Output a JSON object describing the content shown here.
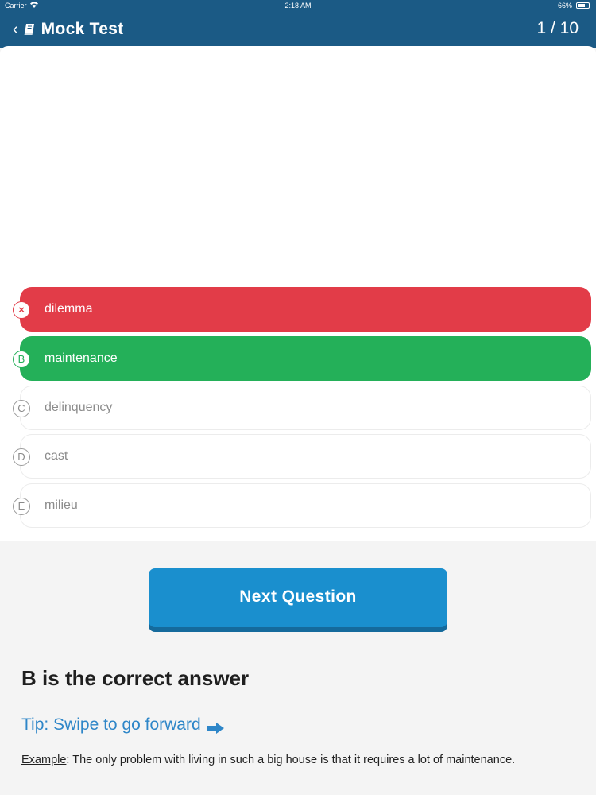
{
  "status_bar": {
    "carrier": "Carrier",
    "time": "2:18 AM",
    "battery": "66%"
  },
  "header": {
    "back_icon": "chevron-left-icon",
    "book_icon": "book-icon",
    "title": "Mock Test",
    "progress": "1 / 10",
    "bg_color": "#1b5a85"
  },
  "question": {
    "text": ""
  },
  "options": [
    {
      "marker": "×",
      "label": "dilemma",
      "state": "wrong"
    },
    {
      "marker": "B",
      "label": "maintenance",
      "state": "correct"
    },
    {
      "marker": "C",
      "label": "delinquency",
      "state": "neutral"
    },
    {
      "marker": "D",
      "label": "cast",
      "state": "neutral"
    },
    {
      "marker": "E",
      "label": "milieu",
      "state": "neutral"
    }
  ],
  "next_button": {
    "label": "Next Question"
  },
  "result": {
    "heading": "B is the correct answer",
    "tip": "Tip: Swipe to go forward",
    "tip_icon": "arrow-right-icon",
    "example_label": "Example",
    "example_text": ": The only problem with living in such a big house is that it requires a lot of maintenance."
  },
  "colors": {
    "wrong": "#e23c48",
    "correct": "#24b059",
    "button": "#1a8fce",
    "tip": "#2e86c8"
  }
}
